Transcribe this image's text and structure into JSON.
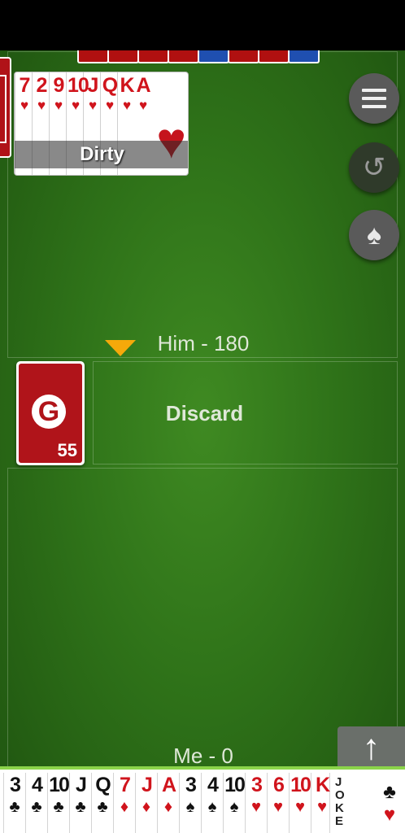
{
  "opponent": {
    "hand_colors": [
      "red",
      "red",
      "red",
      "red",
      "blue",
      "red",
      "red",
      "blue"
    ],
    "score_text": "Him - 180"
  },
  "meld": {
    "ranks": [
      "7",
      "2",
      "9",
      "10",
      "J",
      "Q",
      "K",
      "A"
    ],
    "suit": "♥",
    "label": "Dirty"
  },
  "controls": {
    "menu_icon": "menu-icon",
    "undo_symbol": "↺",
    "spade_symbol": "♠",
    "sort_symbol": "↑"
  },
  "draw_pile": {
    "logo": "G",
    "count": "55"
  },
  "discard": {
    "label": "Discard"
  },
  "player": {
    "score_text": "Me - 0",
    "hand": [
      {
        "rank": "3",
        "suit": "♣",
        "color": "black"
      },
      {
        "rank": "4",
        "suit": "♣",
        "color": "black"
      },
      {
        "rank": "10",
        "suit": "♣",
        "color": "black"
      },
      {
        "rank": "J",
        "suit": "♣",
        "color": "black"
      },
      {
        "rank": "Q",
        "suit": "♣",
        "color": "black"
      },
      {
        "rank": "7",
        "suit": "♦",
        "color": "red"
      },
      {
        "rank": "J",
        "suit": "♦",
        "color": "red"
      },
      {
        "rank": "A",
        "suit": "♦",
        "color": "red"
      },
      {
        "rank": "3",
        "suit": "♠",
        "color": "black"
      },
      {
        "rank": "4",
        "suit": "♠",
        "color": "black"
      },
      {
        "rank": "10",
        "suit": "♠",
        "color": "black"
      },
      {
        "rank": "3",
        "suit": "♥",
        "color": "red"
      },
      {
        "rank": "6",
        "suit": "♥",
        "color": "red"
      },
      {
        "rank": "10",
        "suit": "♥",
        "color": "red"
      },
      {
        "rank": "K",
        "suit": "♥",
        "color": "red"
      }
    ],
    "joker_text": "JOKE",
    "last_suits": [
      "♣",
      "♥"
    ]
  }
}
